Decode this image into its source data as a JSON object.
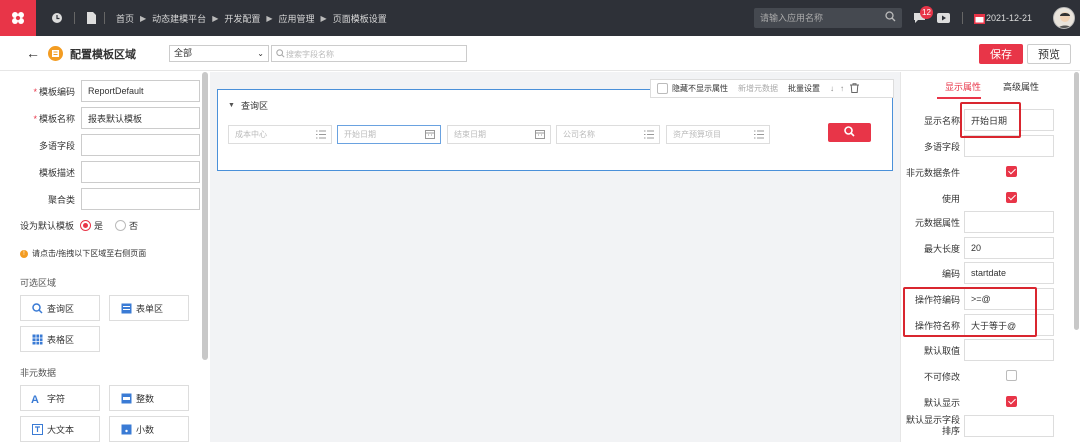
{
  "topbar": {
    "breadcrumbs": [
      "首页",
      "动态建模平台",
      "开发配置",
      "应用管理",
      "页面模板设置"
    ],
    "search_placeholder": "请输入应用名称",
    "notification_count": "12",
    "date": "2021-12-21"
  },
  "header": {
    "title": "配置模板区域",
    "scope_select": "全部",
    "field_search_placeholder": "搜索字段名称",
    "save_label": "保存",
    "preview_label": "预览"
  },
  "left": {
    "fields": [
      {
        "label": "模板编码",
        "required": true,
        "value": "ReportDefault"
      },
      {
        "label": "模板名称",
        "required": true,
        "value": "报表默认模板"
      },
      {
        "label": "多语字段",
        "required": false,
        "value": ""
      },
      {
        "label": "模板描述",
        "required": false,
        "value": ""
      },
      {
        "label": "聚合类",
        "required": false,
        "value": ""
      }
    ],
    "default_label": "设为默认模板",
    "yes_label": "是",
    "no_label": "否",
    "hint": "请点击/拖拽以下区域至右侧页面",
    "areas_title": "可选区域",
    "areas": [
      "查询区",
      "表单区",
      "表格区"
    ],
    "nonmeta_title": "非元数据",
    "nonmeta": [
      "字符",
      "整数",
      "大文本",
      "小数"
    ]
  },
  "center": {
    "toolbar": {
      "hide_label": "隐藏不显示属性",
      "add_label": "新增元数据",
      "batch_label": "批量设置"
    },
    "query_title": "查询区",
    "query_fields": [
      "成本中心",
      "开始日期",
      "结束日期",
      "公司名称",
      "资产预算项目"
    ]
  },
  "right": {
    "tabs": [
      "显示属性",
      "高级属性"
    ],
    "props": [
      {
        "label": "显示名称",
        "type": "input",
        "value": "开始日期"
      },
      {
        "label": "多语字段",
        "type": "input",
        "value": ""
      },
      {
        "label": "非元数据条件",
        "type": "checkbox",
        "checked": true
      },
      {
        "label": "使用",
        "type": "checkbox",
        "checked": true
      },
      {
        "label": "元数据属性",
        "type": "input",
        "value": ""
      },
      {
        "label": "最大长度",
        "type": "input",
        "value": "20"
      },
      {
        "label": "编码",
        "type": "input",
        "value": "startdate"
      },
      {
        "label": "操作符编码",
        "type": "input",
        "value": ">=@"
      },
      {
        "label": "操作符名称",
        "type": "input",
        "value": "大于等于@"
      },
      {
        "label": "默认取值",
        "type": "input",
        "value": ""
      },
      {
        "label": "不可修改",
        "type": "checkbox",
        "checked": false
      },
      {
        "label": "默认显示",
        "type": "checkbox",
        "checked": true
      },
      {
        "label": "默认显示字段排序",
        "type": "input",
        "value": ""
      }
    ]
  },
  "colors": {
    "accent": "#e83548",
    "topbar": "#2e3138",
    "highlight": "#d9262f"
  }
}
